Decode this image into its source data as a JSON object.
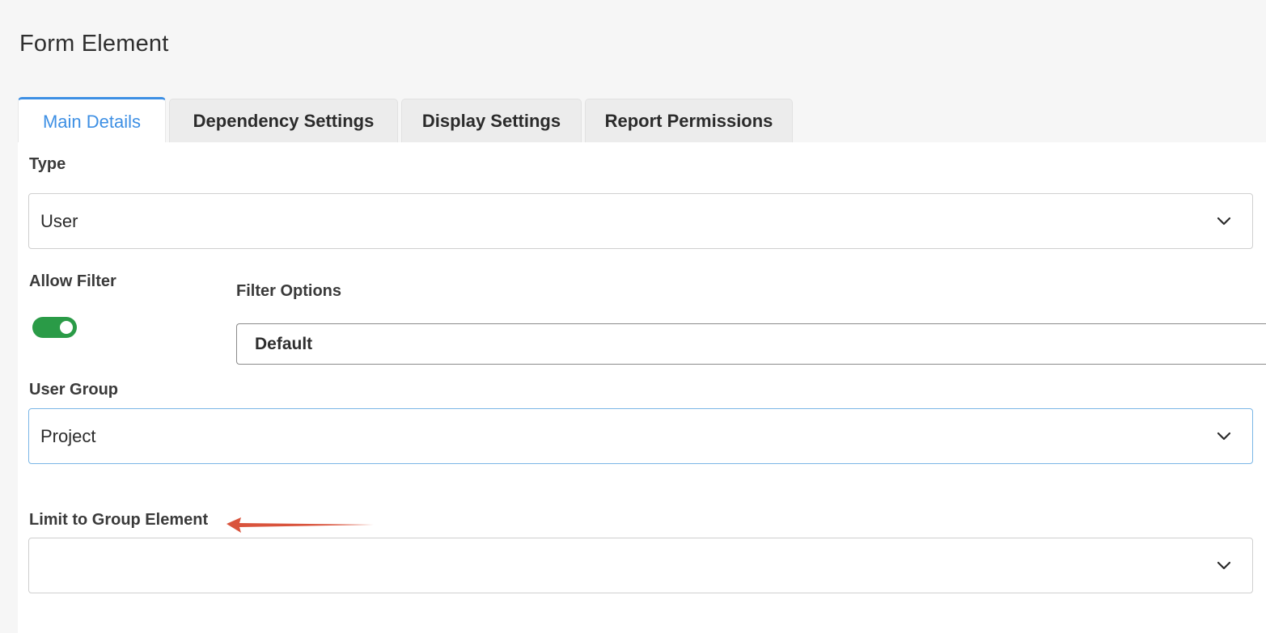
{
  "page": {
    "title": "Form Element"
  },
  "tabs": [
    {
      "label": "Main Details",
      "active": true
    },
    {
      "label": "Dependency Settings",
      "active": false
    },
    {
      "label": "Display Settings",
      "active": false
    },
    {
      "label": "Report Permissions",
      "active": false
    }
  ],
  "form": {
    "type": {
      "label": "Type",
      "value": "User",
      "icon": "chevron-down-icon"
    },
    "allow_filter": {
      "label": "Allow Filter",
      "checked": true
    },
    "filter_options": {
      "label": "Filter Options",
      "value": "Default"
    },
    "user_group": {
      "label": "User Group",
      "value": "Project",
      "icon": "chevron-down-icon"
    },
    "limit_to_group_element": {
      "label": "Limit to Group Element",
      "value": "",
      "icon": "chevron-down-icon"
    }
  },
  "annotation": {
    "icon": "red-arrow-icon",
    "color": "#d9533c"
  },
  "colors": {
    "accent": "#3d8fe4",
    "toggle_on": "#2a9b47",
    "focus_border": "#7ab6e6"
  }
}
